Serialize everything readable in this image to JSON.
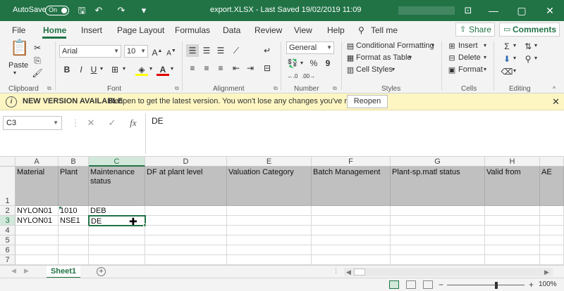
{
  "titlebar": {
    "autosave_label": "AutoSave",
    "autosave_state": "On",
    "title": "export.XLSX  -  Last Saved 19/02/2019 11:09",
    "minimize": "—",
    "restore": "▢",
    "close": "✕"
  },
  "menu": {
    "tabs": [
      "File",
      "Home",
      "Insert",
      "Page Layout",
      "Formulas",
      "Data",
      "Review",
      "View",
      "Help"
    ],
    "tell_me": "Tell me",
    "share": "Share",
    "comments": "Comments"
  },
  "ribbon": {
    "clipboard": {
      "paste": "Paste",
      "label": "Clipboard"
    },
    "font": {
      "name": "Arial",
      "size": "10",
      "bold": "B",
      "italic": "I",
      "underline": "U",
      "label": "Font"
    },
    "alignment": {
      "label": "Alignment"
    },
    "number": {
      "format": "General",
      "label": "Number",
      "percent": "%",
      "comma": "9"
    },
    "styles": {
      "conditional": "Conditional Formatting",
      "table": "Format as Table",
      "cell_styles": "Cell Styles",
      "label": "Styles"
    },
    "cells": {
      "insert": "Insert",
      "delete": "Delete",
      "format": "Format",
      "label": "Cells"
    },
    "editing": {
      "label": "Editing"
    }
  },
  "notification": {
    "heading": "NEW VERSION AVAILABLE",
    "message": "Reopen to get the latest version. You won't lose any changes you've made.",
    "button": "Reopen"
  },
  "formula_bar": {
    "name_box": "C3",
    "fx": "fx",
    "content": "DE"
  },
  "grid": {
    "columns": [
      "A",
      "B",
      "C",
      "D",
      "E",
      "F",
      "G",
      "H"
    ],
    "rows": [
      "1",
      "2",
      "3",
      "4",
      "5",
      "6",
      "7"
    ],
    "header_row": [
      "Material",
      "Plant",
      "Maintenance status",
      "DF at plant level",
      "Valuation Category",
      "Batch Management",
      "Plant-sp.matl status",
      "Valid from",
      "AE"
    ],
    "data_rows": [
      [
        "NYLON01",
        "1010",
        "DEB",
        "",
        "",
        "",
        "",
        ""
      ],
      [
        "NYLON01",
        "NSE1",
        "DE",
        "",
        "",
        "",
        "",
        ""
      ]
    ],
    "active_cell": "C3"
  },
  "sheets": {
    "tabs": [
      "Sheet1"
    ]
  },
  "status": {
    "zoom": "100%"
  },
  "colors": {
    "brand": "#217346",
    "notif": "#fdf6c3"
  }
}
